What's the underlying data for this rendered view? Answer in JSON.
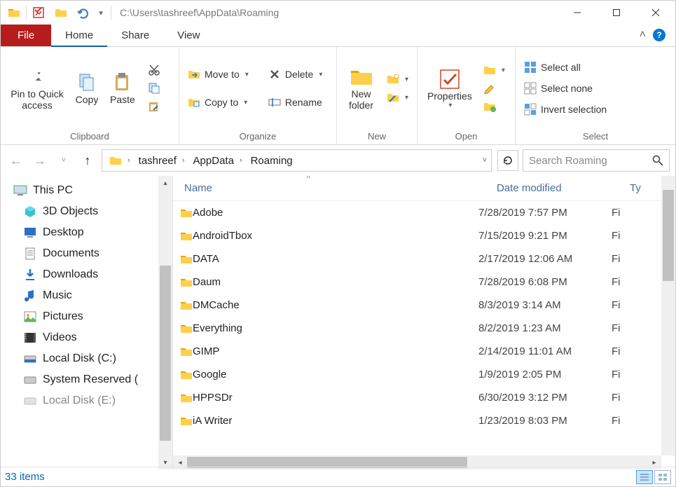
{
  "title_path": "C:\\Users\\tashreef\\AppData\\Roaming",
  "tabs": {
    "file": "File",
    "home": "Home",
    "share": "Share",
    "view": "View"
  },
  "ribbon": {
    "clipboard": {
      "label": "Clipboard",
      "pin": "Pin to Quick access",
      "copy": "Copy",
      "paste": "Paste"
    },
    "organize": {
      "label": "Organize",
      "moveto": "Move to",
      "copyto": "Copy to",
      "delete": "Delete",
      "rename": "Rename"
    },
    "new": {
      "label": "New",
      "newfolder": "New folder"
    },
    "open": {
      "label": "Open",
      "properties": "Properties"
    },
    "select": {
      "label": "Select",
      "all": "Select all",
      "none": "Select none",
      "invert": "Invert selection"
    }
  },
  "breadcrumb": [
    "tashreef",
    "AppData",
    "Roaming"
  ],
  "search_placeholder": "Search Roaming",
  "nav": {
    "thispc": "This PC",
    "items": [
      "3D Objects",
      "Desktop",
      "Documents",
      "Downloads",
      "Music",
      "Pictures",
      "Videos",
      "Local Disk (C:)",
      "System Reserved (",
      "Local Disk (E:)"
    ]
  },
  "columns": {
    "name": "Name",
    "date": "Date modified",
    "type": "Ty"
  },
  "files": [
    {
      "name": "Adobe",
      "date": "7/28/2019 7:57 PM",
      "type": "Fi"
    },
    {
      "name": "AndroidTbox",
      "date": "7/15/2019 9:21 PM",
      "type": "Fi"
    },
    {
      "name": "DATA",
      "date": "2/17/2019 12:06 AM",
      "type": "Fi"
    },
    {
      "name": "Daum",
      "date": "7/28/2019 6:08 PM",
      "type": "Fi"
    },
    {
      "name": "DMCache",
      "date": "8/3/2019 3:14 AM",
      "type": "Fi"
    },
    {
      "name": "Everything",
      "date": "8/2/2019 1:23 AM",
      "type": "Fi"
    },
    {
      "name": "GIMP",
      "date": "2/14/2019 11:01 AM",
      "type": "Fi"
    },
    {
      "name": "Google",
      "date": "1/9/2019 2:05 PM",
      "type": "Fi"
    },
    {
      "name": "HPPSDr",
      "date": "6/30/2019 3:12 PM",
      "type": "Fi"
    },
    {
      "name": "iA Writer",
      "date": "1/23/2019 8:03 PM",
      "type": "Fi"
    }
  ],
  "status": "33 items"
}
